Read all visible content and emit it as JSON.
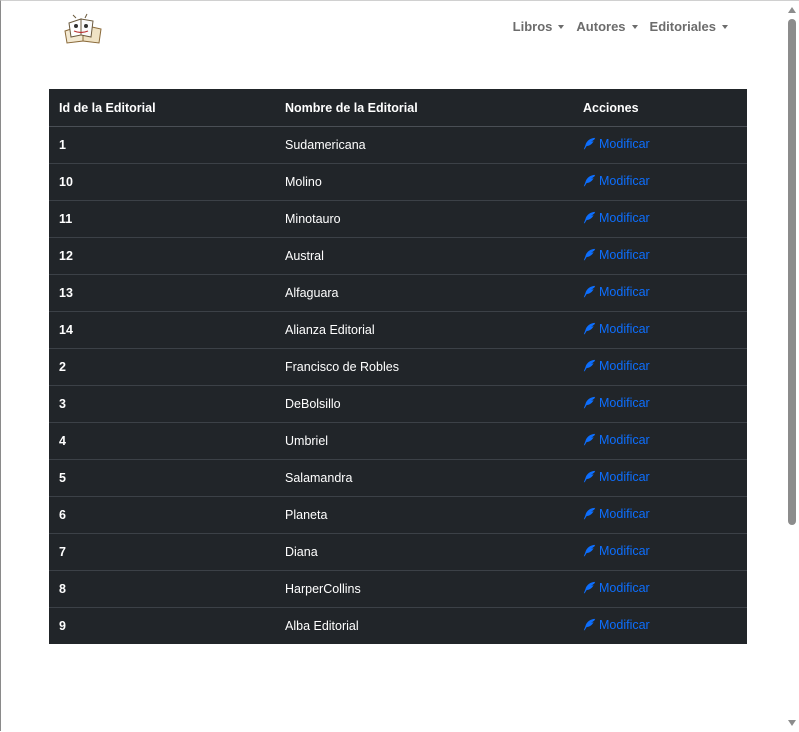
{
  "nav": {
    "items": [
      {
        "label": "Libros"
      },
      {
        "label": "Autores"
      },
      {
        "label": "Editoriales"
      }
    ]
  },
  "table": {
    "headers": [
      "Id de la Editorial",
      "Nombre de la Editorial",
      "Acciones"
    ],
    "rows": [
      {
        "id": "1",
        "name": "Sudamericana",
        "action": "Modificar"
      },
      {
        "id": "10",
        "name": "Molino",
        "action": "Modificar"
      },
      {
        "id": "11",
        "name": "Minotauro",
        "action": "Modificar"
      },
      {
        "id": "12",
        "name": "Austral",
        "action": "Modificar"
      },
      {
        "id": "13",
        "name": "Alfaguara",
        "action": "Modificar"
      },
      {
        "id": "14",
        "name": "Alianza Editorial",
        "action": "Modificar"
      },
      {
        "id": "2",
        "name": "Francisco de Robles",
        "action": "Modificar"
      },
      {
        "id": "3",
        "name": "DeBolsillo",
        "action": "Modificar"
      },
      {
        "id": "4",
        "name": "Umbriel",
        "action": "Modificar"
      },
      {
        "id": "5",
        "name": "Salamandra",
        "action": "Modificar"
      },
      {
        "id": "6",
        "name": "Planeta",
        "action": "Modificar"
      },
      {
        "id": "7",
        "name": "Diana",
        "action": "Modificar"
      },
      {
        "id": "8",
        "name": "HarperCollins",
        "action": "Modificar"
      },
      {
        "id": "9",
        "name": "Alba Editorial",
        "action": "Modificar"
      }
    ]
  },
  "icons": {
    "brand": "books-logo-icon",
    "action": "feather-icon",
    "dropdown": "caret-down-icon"
  },
  "colors": {
    "table_bg": "#212529",
    "link": "#0d6efd",
    "nav_text": "#6c6c6c"
  }
}
